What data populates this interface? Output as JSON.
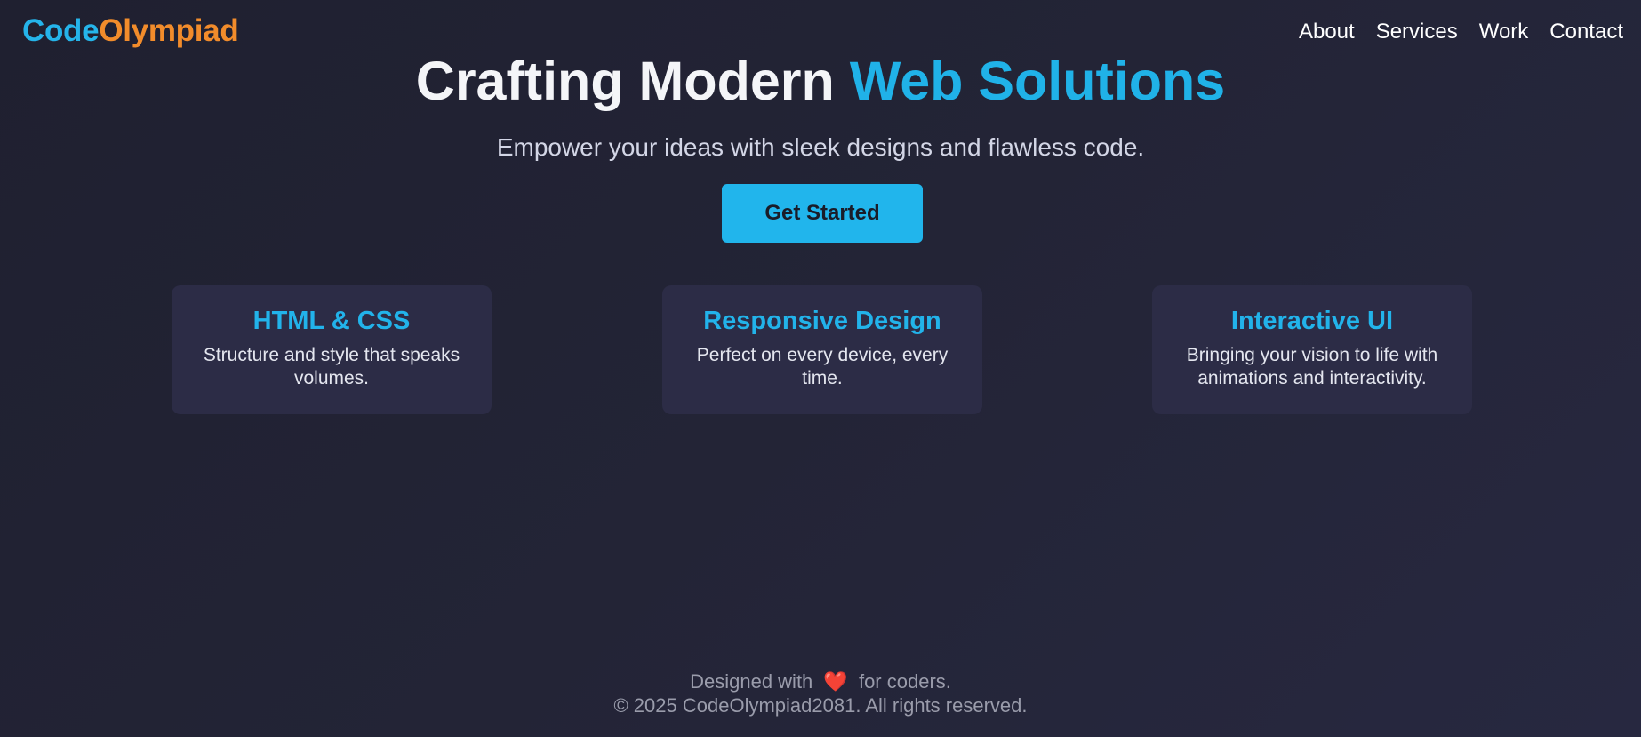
{
  "brand": {
    "part1": "Code",
    "part2": "Olympiad",
    "colors": {
      "part1": "#25b4ea",
      "part2": "#f28c2b"
    }
  },
  "nav": {
    "items": [
      {
        "label": "About"
      },
      {
        "label": "Services"
      },
      {
        "label": "Work"
      },
      {
        "label": "Contact"
      }
    ]
  },
  "hero": {
    "title_plain": "Crafting Modern",
    "title_accent": "Web Solutions",
    "subtitle": "Empower your ideas with sleek designs and flawless code.",
    "cta_label": "Get Started",
    "accent_color": "#20b2e8"
  },
  "features": [
    {
      "title": "HTML & CSS",
      "description": "Structure and style that speaks volumes."
    },
    {
      "title": "Responsive Design",
      "description": "Perfect on every device, every time."
    },
    {
      "title": "Interactive UI",
      "description": "Bringing your vision to life with animations and interactivity."
    }
  ],
  "footer": {
    "designed_prefix": "Designed with",
    "heart_icon": "heart-icon",
    "heart_glyph": "❤️",
    "designed_suffix": "for coders.",
    "copyright": "© 2025 CodeOlympiad2081. All rights reserved."
  }
}
